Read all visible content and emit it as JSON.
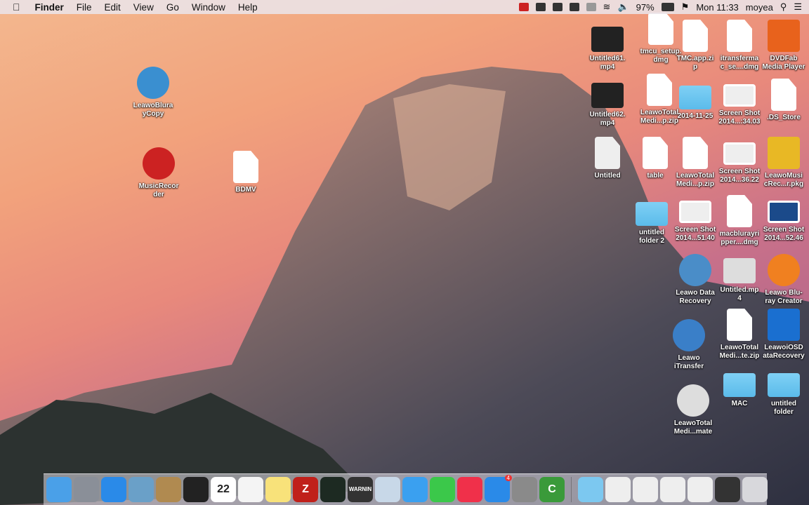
{
  "menubar": {
    "app": "Finder",
    "items": [
      "File",
      "Edit",
      "View",
      "Go",
      "Window",
      "Help"
    ],
    "battery": "97%",
    "clock": "Mon 11:33",
    "user": "moyea"
  },
  "desktop": {
    "icons": [
      {
        "label": "LeawoBlura\nyCopy",
        "kind": "app",
        "color": "#3a8fd0"
      },
      {
        "label": "MusicRecor\nder",
        "kind": "app",
        "color": "#c22"
      },
      {
        "label": "BDMV",
        "kind": "doc",
        "color": "#fff"
      },
      {
        "label": "Untitled61.\nmp4",
        "kind": "video",
        "color": "#222"
      },
      {
        "label": "tmcu_setup.\ndmg",
        "kind": "doc",
        "color": "#fff"
      },
      {
        "label": "TMC.app.zi\np",
        "kind": "doc",
        "color": "#fff"
      },
      {
        "label": "itransferma\nc_se....dmg",
        "kind": "doc",
        "color": "#fff"
      },
      {
        "label": "DVDFab\nMedia Player",
        "kind": "app-sq",
        "color": "#e8621c"
      },
      {
        "label": "Untitled62.\nmp4",
        "kind": "video",
        "color": "#222"
      },
      {
        "label": "LeawoTotal\nMedi...p.zip",
        "kind": "doc",
        "color": "#fff"
      },
      {
        "label": "2014-11-25",
        "kind": "folder",
        "color": "#6cc6f0"
      },
      {
        "label": "Screen Shot\n2014...:34.03",
        "kind": "shot",
        "color": "#eee"
      },
      {
        "label": ".DS_Store",
        "kind": "doc",
        "color": "#fff"
      },
      {
        "label": "Untitled",
        "kind": "doc",
        "color": "#eee"
      },
      {
        "label": "table",
        "kind": "doc",
        "color": "#fff"
      },
      {
        "label": "LeawoTotal\nMedi...p.zip",
        "kind": "doc",
        "color": "#fff"
      },
      {
        "label": "Screen Shot\n2014...36.22",
        "kind": "shot",
        "color": "#eee"
      },
      {
        "label": "LeawoMusi\ncRec...r.pkg",
        "kind": "app-sq",
        "color": "#e8b825"
      },
      {
        "label": "untitled\nfolder 2",
        "kind": "folder",
        "color": "#6cc6f0"
      },
      {
        "label": "Screen Shot\n2014...51.40",
        "kind": "shot",
        "color": "#eee"
      },
      {
        "label": "macblurayri\npper....dmg",
        "kind": "doc",
        "color": "#fff"
      },
      {
        "label": "Screen Shot\n2014...52.46",
        "kind": "shot",
        "color": "#1b4a8a"
      },
      {
        "label": "Leawo Data\nRecovery",
        "kind": "app",
        "color": "#4a8dc8"
      },
      {
        "label": "Untitled.mp\n4",
        "kind": "video",
        "color": "#ddd"
      },
      {
        "label": "Leawo Blu-\nray Creator",
        "kind": "app",
        "color": "#f08020"
      },
      {
        "label": "Leawo\niTransfer",
        "kind": "app",
        "color": "#3a7fc8"
      },
      {
        "label": "LeawoTotal\nMedi...te.zip",
        "kind": "doc",
        "color": "#fff"
      },
      {
        "label": "LeawoiOSD\nataRecovery",
        "kind": "app-sq",
        "color": "#1a6fd0"
      },
      {
        "label": "LeawoTotal\nMedi...mate",
        "kind": "app",
        "color": "#ddd"
      },
      {
        "label": "MAC",
        "kind": "folder",
        "color": "#6cc6f0"
      },
      {
        "label": "untitled\nfolder",
        "kind": "folder",
        "color": "#6cc6f0"
      }
    ]
  },
  "dock": {
    "items": [
      {
        "name": "finder",
        "color": "#4aa0e8"
      },
      {
        "name": "launchpad",
        "color": "#8a8f98"
      },
      {
        "name": "safari",
        "color": "#2a8ae8"
      },
      {
        "name": "preview",
        "color": "#6aa0c8"
      },
      {
        "name": "contacts",
        "color": "#b08a50"
      },
      {
        "name": "terminal",
        "color": "#222"
      },
      {
        "name": "calendar",
        "color": "#fff",
        "text": "22"
      },
      {
        "name": "reminders",
        "color": "#f4f4f4"
      },
      {
        "name": "notes",
        "color": "#f8e27a"
      },
      {
        "name": "filezilla",
        "color": "#c0201a",
        "text": "Z"
      },
      {
        "name": "activity-monitor",
        "color": "#1d2a22"
      },
      {
        "name": "console",
        "color": "#333",
        "text": "WARNIN"
      },
      {
        "name": "image-capture",
        "color": "#c8d8e8"
      },
      {
        "name": "messages",
        "color": "#3aa0f0"
      },
      {
        "name": "facetime",
        "color": "#3bc84a"
      },
      {
        "name": "itunes",
        "color": "#f0304a"
      },
      {
        "name": "app-store",
        "color": "#2a8ae8",
        "badge": "4"
      },
      {
        "name": "system-preferences",
        "color": "#8a8a8a"
      },
      {
        "name": "camtasia",
        "color": "#3a9a3a",
        "text": "C"
      },
      {
        "sep": true
      },
      {
        "name": "applications-stack",
        "color": "#7cc8f0"
      },
      {
        "name": "document-stack-1",
        "color": "#eee"
      },
      {
        "name": "document-stack-2",
        "color": "#eee"
      },
      {
        "name": "document-stack-3",
        "color": "#eee"
      },
      {
        "name": "document-stack-4",
        "color": "#eee"
      },
      {
        "name": "document-stack-5",
        "color": "#333"
      },
      {
        "name": "trash",
        "color": "#d8d8dc"
      }
    ]
  }
}
